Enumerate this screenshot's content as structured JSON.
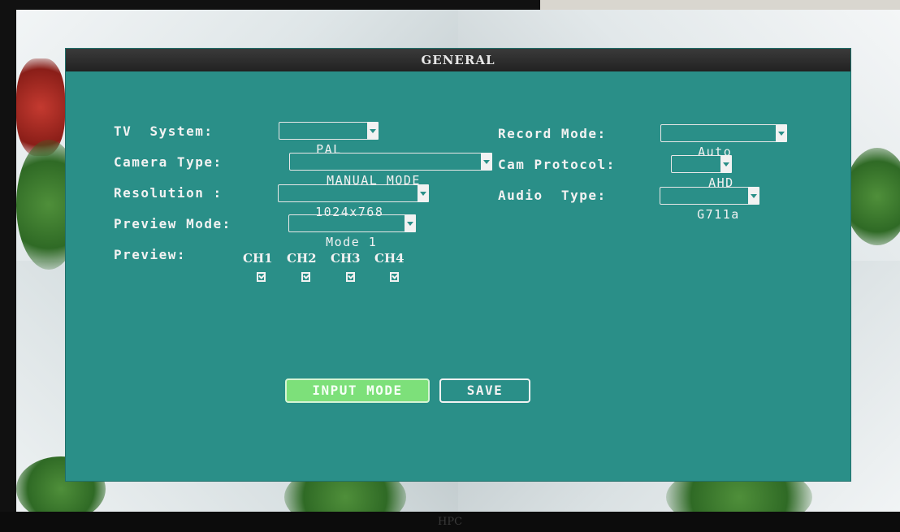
{
  "window": {
    "title": "GENERAL",
    "bezel_brand": "HPC"
  },
  "fields": {
    "tv_system": {
      "label": "TV  System:",
      "value": "PAL"
    },
    "camera_type": {
      "label": "Camera Type:",
      "value": "MANUAL MODE"
    },
    "resolution": {
      "label": "Resolution :",
      "value": "1024x768"
    },
    "preview_mode": {
      "label": "Preview Mode:",
      "value": "Mode 1"
    },
    "record_mode": {
      "label": "Record Mode:",
      "value": "Auto"
    },
    "cam_protocol": {
      "label": "Cam Protocol:",
      "value": "AHD"
    },
    "audio_type": {
      "label": "Audio  Type:",
      "value": "G711a"
    }
  },
  "preview": {
    "label": "Preview:",
    "channels": [
      {
        "name": "CH1",
        "checked": true
      },
      {
        "name": "CH2",
        "checked": true
      },
      {
        "name": "CH3",
        "checked": true
      },
      {
        "name": "CH4",
        "checked": true
      }
    ]
  },
  "buttons": {
    "input_mode": "INPUT MODE",
    "save": "SAVE"
  },
  "colors": {
    "panel": "#2a8f88",
    "title_bar": "#2a2a2a",
    "active_button": "#7de07a",
    "text": "#f2f2f2"
  }
}
